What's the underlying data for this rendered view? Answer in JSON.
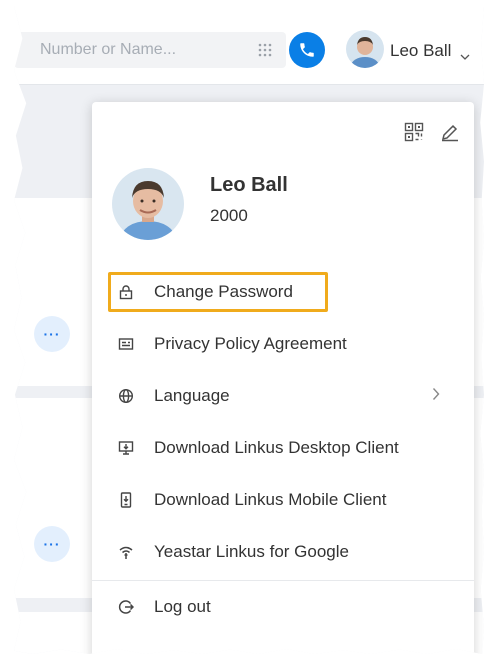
{
  "header": {
    "search_placeholder": "Number or Name...",
    "user_name": "Leo Ball"
  },
  "profile": {
    "name": "Leo Ball",
    "extension": "2000"
  },
  "menu": {
    "items": [
      {
        "label": "Change Password",
        "icon": "lock-icon"
      },
      {
        "label": "Privacy Policy Agreement",
        "icon": "document-icon"
      },
      {
        "label": "Language",
        "icon": "globe-icon"
      },
      {
        "label": "Download Linkus Desktop Client",
        "icon": "desktop-download-icon"
      },
      {
        "label": "Download Linkus Mobile Client",
        "icon": "mobile-download-icon"
      },
      {
        "label": "Yeastar Linkus for Google",
        "icon": "google-extension-icon"
      },
      {
        "label": "Log out",
        "icon": "logout-icon"
      }
    ]
  },
  "colors": {
    "accent": "#0a7fe6",
    "highlight_border": "#f0ab1c",
    "text": "#333333"
  }
}
